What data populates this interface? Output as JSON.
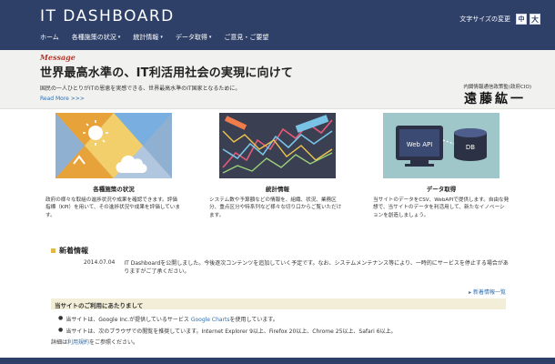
{
  "header": {
    "logo": "IT DASHBOARD",
    "fontsize_label": "文字サイズの変更",
    "fontsize_small": "中",
    "fontsize_large": "大"
  },
  "nav": [
    {
      "label": "ホーム",
      "dropdown": false
    },
    {
      "label": "各種施策の状況",
      "dropdown": true
    },
    {
      "label": "統計情報",
      "dropdown": true
    },
    {
      "label": "データ取得",
      "dropdown": true
    },
    {
      "label": "ご意見・ご要望",
      "dropdown": false
    }
  ],
  "message": {
    "kicker": "Message",
    "title": "世界最高水準の、IT利活用社会の実現に向けて",
    "sub": "国民の一人ひとりがITの恩恵を実感できる、世界最高水準のIT国家となるために。",
    "more": "Read More >>>",
    "cio_title": "内閣情報通信政策監(政府CIO)",
    "cio_name": "遠藤紘一"
  },
  "cards": [
    {
      "title": "各種施策の状況",
      "desc": "政府の様々な取組の進捗状況や成果を確認できます。評価指標（KPI）を用いて、その進捗状況や成果を評価しています。"
    },
    {
      "title": "統計情報",
      "desc": "システム数や予算額などの情報を、組織、状況、業務区分、重点区分や特系列など様々な切り口からご覧いただけます。"
    },
    {
      "title": "データ取得",
      "desc": "当サイトのデータをCSV、WebAPIで提供します。自由な発想で、当サイトのデータを利活用して、新たなイノベーションを創造しましょう。",
      "art_label_1": "Web API",
      "art_label_2": "DB"
    }
  ],
  "news": {
    "heading": "新着情報",
    "items": [
      {
        "date": "2014.07.04",
        "text": "IT Dashboardを公開しました。今後逐次コンテンツを追加していく予定です。なお、システムメンテナンス等により、一時的にサービスを停止する場合がありますがご了承ください。"
      }
    ],
    "more_label": "新着情報一覧"
  },
  "notice": {
    "heading": "当サイトのご利用にあたりまして",
    "items": [
      {
        "pre": "当サイトは、Google Inc.が提供しているサービス ",
        "link": "Google Charts",
        "post": "を使用しています。"
      },
      {
        "pre": "当サイトは、次のブラウザでの閲覧を推奨しています。Internet Explorer 9以上、Firefox 20以上、Chrome 25以上、Safari 6以上。",
        "link": "",
        "post": ""
      }
    ],
    "foot_pre": "詳細は",
    "foot_link": "利用規約",
    "foot_post": "をご参照ください。"
  },
  "colors": {
    "header_bg": "#2f4068",
    "accent_red": "#b43a2e",
    "link_blue": "#2f6fb1",
    "notice_bg": "#f2eed8"
  }
}
